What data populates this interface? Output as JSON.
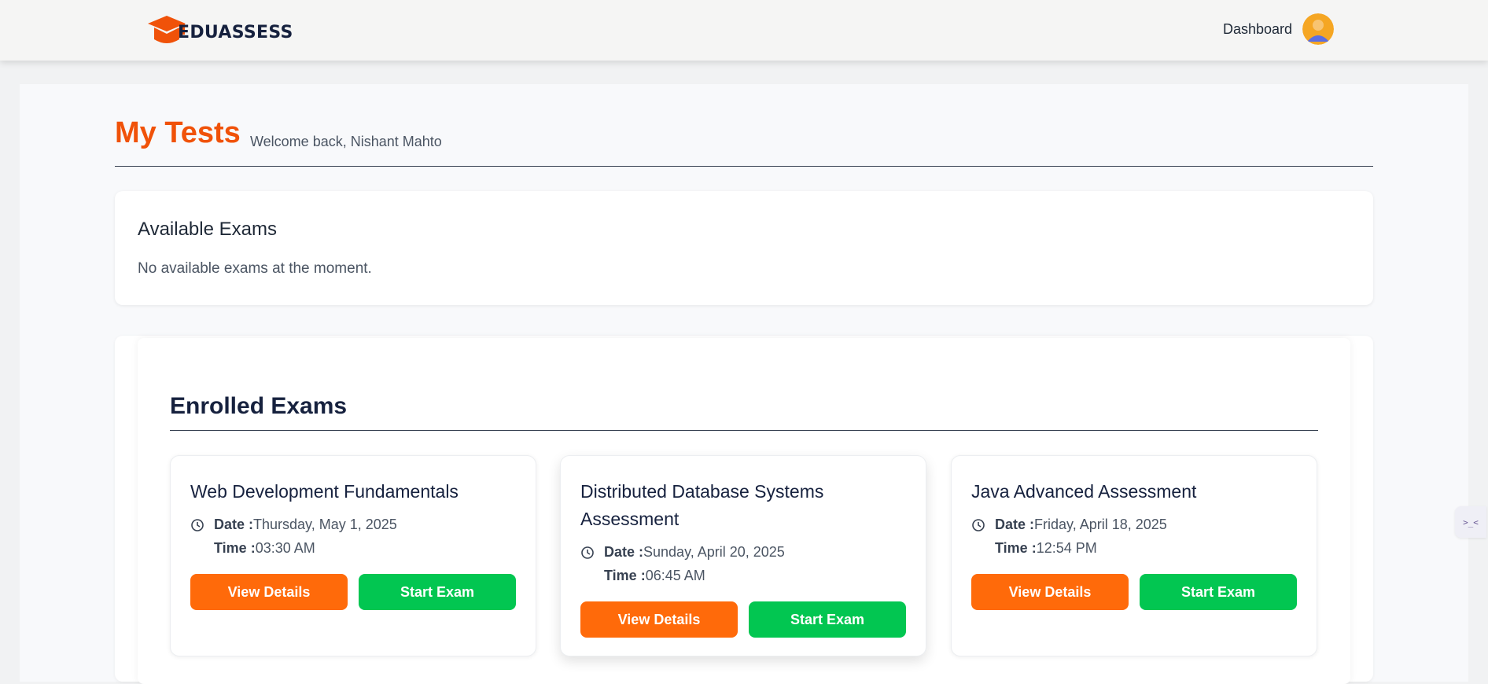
{
  "header": {
    "brand": "EDUASSESS",
    "nav_dashboard": "Dashboard",
    "brand_color": "#f05209"
  },
  "page": {
    "title": "My Tests",
    "welcome": "Welcome back, Nishant Mahto"
  },
  "available": {
    "title": "Available Exams",
    "empty_text": "No available exams at the moment."
  },
  "enrolled": {
    "title": "Enrolled Exams",
    "exams": [
      {
        "title": "Web Development Fundamentals",
        "date_label": "Date :",
        "date": "Thursday, May 1, 2025",
        "time_label": "Time :",
        "time": "03:30 AM",
        "details_label": "View Details",
        "start_label": "Start Exam"
      },
      {
        "title": "Distributed Database Systems Assessment",
        "date_label": "Date :",
        "date": "Sunday, April 20, 2025",
        "time_label": "Time :",
        "time": "06:45 AM",
        "details_label": "View Details",
        "start_label": "Start Exam"
      },
      {
        "title": "Java Advanced Assessment",
        "date_label": "Date :",
        "date": "Friday, April 18, 2025",
        "time_label": "Time :",
        "time": "12:54 PM",
        "details_label": "View Details",
        "start_label": "Start Exam"
      }
    ]
  },
  "side_widget": {
    "text": ">_<"
  },
  "colors": {
    "accent_orange": "#ff6a0a",
    "accent_green": "#02c651",
    "title_orange": "#f05209"
  }
}
